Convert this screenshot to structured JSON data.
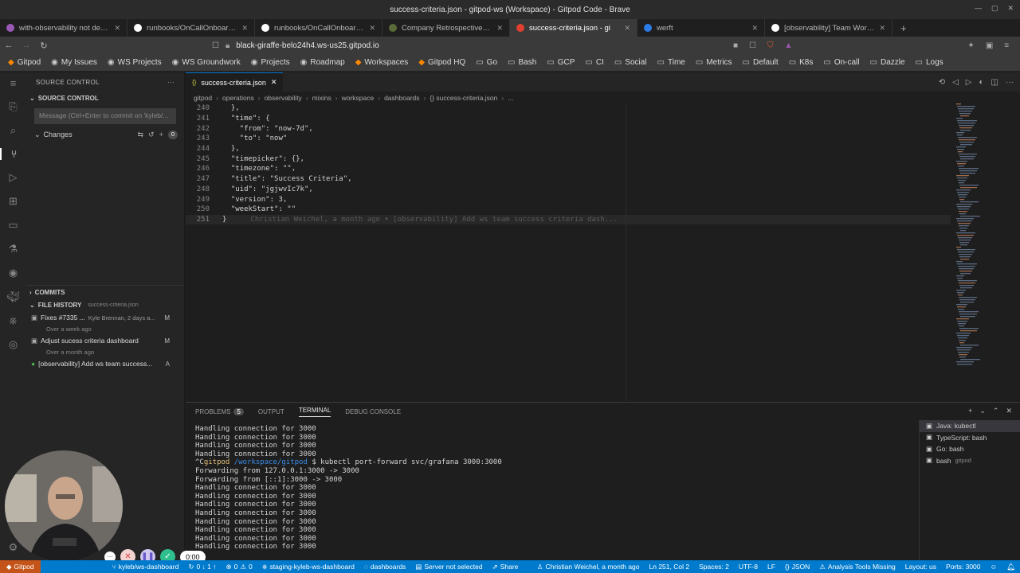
{
  "window": {
    "title": "success-criteria.json - gitpod-ws (Workspace) - Gitpod Code - Brave"
  },
  "browser": {
    "tabs": [
      {
        "label": "with-observability not deploy",
        "favicon": "#9b59b6"
      },
      {
        "label": "runbooks/OnCallOnboarding",
        "favicon": "#ffffff"
      },
      {
        "label": "runbooks/OnCallOnboarding",
        "favicon": "#ffffff"
      },
      {
        "label": "Company Retrospectives for C",
        "favicon": "#5a6b3a"
      },
      {
        "label": "success-criteria.json - gi",
        "favicon": "#e0402f",
        "active": true
      },
      {
        "label": "werft",
        "favicon": "#2d7be5"
      },
      {
        "label": "[observability] Team Worksp",
        "favicon": "#ffffff"
      }
    ],
    "new_tab": "+",
    "url": "black-giraffe-belo24h4.ws-us25.gitpod.io",
    "bookmarks": [
      {
        "label": "Gitpod",
        "icon": "gitpod-icon"
      },
      {
        "label": "My Issues",
        "icon": "github-icon"
      },
      {
        "label": "WS Projects",
        "icon": "github-icon"
      },
      {
        "label": "WS Groundwork",
        "icon": "github-icon"
      },
      {
        "label": "Projects",
        "icon": "github-icon"
      },
      {
        "label": "Roadmap",
        "icon": "github-icon"
      },
      {
        "label": "Workspaces",
        "icon": "gitpod-icon"
      },
      {
        "label": "Gitpod HQ",
        "icon": "gitpod-icon"
      },
      {
        "label": "Go",
        "icon": "folder-icon"
      },
      {
        "label": "Bash",
        "icon": "folder-icon"
      },
      {
        "label": "GCP",
        "icon": "folder-icon"
      },
      {
        "label": "CI",
        "icon": "folder-icon"
      },
      {
        "label": "Social",
        "icon": "folder-icon"
      },
      {
        "label": "Time",
        "icon": "folder-icon"
      },
      {
        "label": "Metrics",
        "icon": "folder-icon"
      },
      {
        "label": "Default",
        "icon": "folder-icon"
      },
      {
        "label": "K8s",
        "icon": "folder-icon"
      },
      {
        "label": "On-call",
        "icon": "folder-icon"
      },
      {
        "label": "Dazzle",
        "icon": "folder-icon"
      },
      {
        "label": "Logs",
        "icon": "folder-icon"
      }
    ]
  },
  "sidebar": {
    "header": "SOURCE CONTROL",
    "section": "SOURCE CONTROL",
    "commit_placeholder": "Message (Ctrl+Enter to commit on 'kyleb/...",
    "changes_label": "Changes",
    "changes_count": "0",
    "commits_label": "COMMITS",
    "file_history_label": "FILE HISTORY",
    "file_history_file": "success-criteria.json",
    "history": [
      {
        "message": "Fixes #7335 ...",
        "meta": "Kyle Brennan, 2 days a...",
        "status": "M",
        "sub": "Over a week ago"
      },
      {
        "message": "Adjust sucess criteria dashboard",
        "meta": "",
        "status": "M",
        "sub": "Over a month ago"
      },
      {
        "message": "[observability] Add ws team success...",
        "meta": "",
        "status": "A",
        "sub": ""
      }
    ]
  },
  "editor": {
    "tab": "success-criteria.json",
    "breadcrumb": [
      "gitpod",
      "operations",
      "observability",
      "mixins",
      "workspace",
      "dashboards",
      "{} success-criteria.json",
      "..."
    ],
    "lines": [
      {
        "n": "240",
        "t": "  },"
      },
      {
        "n": "241",
        "t": "  \"time\": {"
      },
      {
        "n": "242",
        "t": "    \"from\": \"now-7d\","
      },
      {
        "n": "243",
        "t": "    \"to\": \"now\""
      },
      {
        "n": "244",
        "t": "  },"
      },
      {
        "n": "245",
        "t": "  \"timepicker\": {},"
      },
      {
        "n": "246",
        "t": "  \"timezone\": \"\","
      },
      {
        "n": "247",
        "t": "  \"title\": \"Success Criteria\","
      },
      {
        "n": "248",
        "t": "  \"uid\": \"jgjwvIc7k\","
      },
      {
        "n": "249",
        "t": "  \"version\": 3,"
      },
      {
        "n": "250",
        "t": "  \"weekStart\": \"\""
      },
      {
        "n": "251",
        "t": "}"
      }
    ],
    "blame": "Christian Weichel, a month ago • [observability] Add ws team success criteria dash..."
  },
  "panel": {
    "tabs": [
      "PROBLEMS",
      "OUTPUT",
      "TERMINAL",
      "DEBUG CONSOLE"
    ],
    "problems_count": "5",
    "terminal_lines": [
      "Handling connection for 3000",
      "Handling connection for 3000",
      "Handling connection for 3000",
      "Handling connection for 3000",
      "Forwarding from 127.0.0.1:3000 -> 3000",
      "Forwarding from [::1]:3000 -> 3000",
      "Handling connection for 3000",
      "Handling connection for 3000",
      "Handling connection for 3000",
      "Handling connection for 3000",
      "Handling connection for 3000",
      "Handling connection for 3000",
      "Handling connection for 3000",
      "Handling connection for 3000"
    ],
    "prompt": {
      "ctrl": "^C",
      "user": "gitpod",
      "path": "/workspace/gitpod",
      "cmd": "$ kubectl port-forward svc/grafana 3000:3000"
    },
    "terminals": [
      {
        "label": "Java: kubectl",
        "sub": ""
      },
      {
        "label": "TypeScript: bash",
        "sub": ""
      },
      {
        "label": "Go: bash",
        "sub": ""
      },
      {
        "label": "bash",
        "sub": "gitpod"
      }
    ]
  },
  "recording": {
    "timer": "0:00"
  },
  "statusbar": {
    "remote": "Gitpod",
    "branch": "kyleb/ws-dashboard",
    "sync": "0 ↓ 1 ↑",
    "errors": "0",
    "warnings": "0",
    "context": "staging-kyleb-ws-dashboard",
    "namespace": "dashboards",
    "server": "Server not selected",
    "share": "Share",
    "blame": "Christian Weichel, a month ago",
    "position": "Ln 251, Col 2",
    "spaces": "Spaces: 2",
    "encoding": "UTF-8",
    "eol": "LF",
    "language": "JSON",
    "analysis": "Analysis Tools Missing",
    "layout": "Layout: us",
    "ports": "Ports: 3000"
  },
  "colors": {
    "accent": "#007acc",
    "remote": "#c5541a"
  }
}
